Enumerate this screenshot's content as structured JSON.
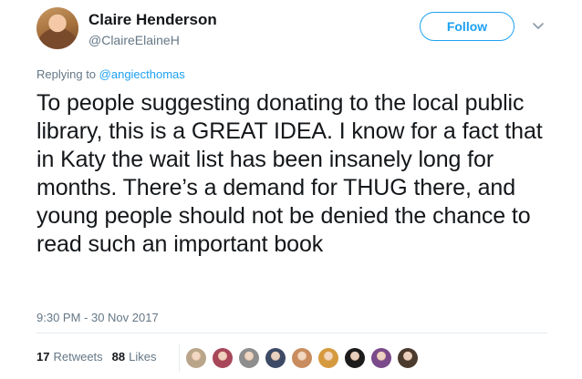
{
  "author": {
    "name": "Claire Henderson",
    "handle": "@ClaireElaineH"
  },
  "follow_label": "Follow",
  "reply": {
    "prefix": "Replying to ",
    "to": "@angiecthomas"
  },
  "text": "To people suggesting donating to the local public library, this is a GREAT IDEA. I know for a fact that in Katy the wait list has been insanely long for months. There’s a demand for THUG there, and young people should not be denied the chance to read such an important book",
  "timestamp": "9:30 PM - 30 Nov 2017",
  "stats": {
    "retweets_count": "17",
    "retweets_label": "Retweets",
    "likes_count": "88",
    "likes_label": "Likes"
  },
  "colors": {
    "accent": "#1da1f2",
    "muted": "#657786",
    "text": "#14171a",
    "divider": "#e6ecf0"
  },
  "liker_avatars": [
    {
      "name": "liker-1",
      "color": "#b9a58a"
    },
    {
      "name": "liker-2",
      "color": "#a8475a"
    },
    {
      "name": "liker-3",
      "color": "#8e8e8e"
    },
    {
      "name": "liker-4",
      "color": "#3d4a66"
    },
    {
      "name": "liker-5",
      "color": "#c98c5e"
    },
    {
      "name": "liker-6",
      "color": "#d59a3e"
    },
    {
      "name": "liker-7",
      "color": "#1c1c1c"
    },
    {
      "name": "liker-8",
      "color": "#7a4a8a"
    },
    {
      "name": "liker-9",
      "color": "#4b3a2e"
    }
  ]
}
